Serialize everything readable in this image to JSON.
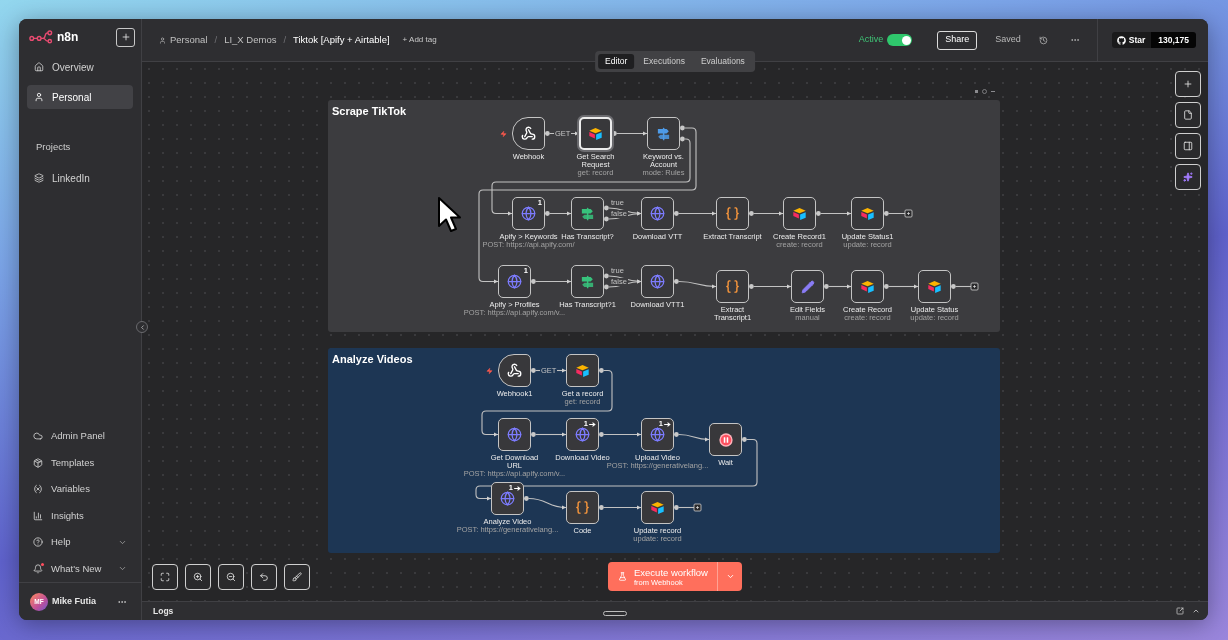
{
  "sidebar": {
    "logo": "n8n",
    "nav": [
      {
        "label": "Overview",
        "selected": false
      },
      {
        "label": "Personal",
        "selected": true
      }
    ],
    "projects_title": "Projects",
    "projects": [
      {
        "label": "LinkedIn",
        "selected": false
      }
    ],
    "bottom_nav": [
      {
        "label": "Admin Panel",
        "expandable": false,
        "notification": false
      },
      {
        "label": "Templates",
        "expandable": false,
        "notification": false
      },
      {
        "label": "Variables",
        "expandable": false,
        "notification": false
      },
      {
        "label": "Insights",
        "expandable": false,
        "notification": false
      },
      {
        "label": "Help",
        "expandable": true,
        "notification": false
      },
      {
        "label": "What's New",
        "expandable": true,
        "notification": true
      }
    ],
    "user": {
      "initials": "MF",
      "name": "Mike Futia"
    }
  },
  "header": {
    "breadcrumb": [
      {
        "label": "Personal",
        "separator": "/"
      },
      {
        "label": "LI_X Demos",
        "separator": "/"
      },
      {
        "label": "Tiktok [Apify + Airtable]"
      }
    ],
    "add_tag": "+ Add tag",
    "active": {
      "label": "Active",
      "on": true
    },
    "share": "Share",
    "saved": "Saved",
    "github": {
      "label": "Star",
      "count": "130,175"
    }
  },
  "view_tabs": [
    {
      "label": "Editor",
      "selected": true
    },
    {
      "label": "Executions",
      "selected": false
    },
    {
      "label": "Evaluations",
      "selected": false
    }
  ],
  "canvas": {
    "notes": [
      {
        "title": "Scrape TikTok",
        "color": "#3c3c3f",
        "nodes": [
          {
            "kind": "webhook",
            "label": "Webhook",
            "output_labels": [
              "GET"
            ],
            "selected": false
          },
          {
            "kind": "airtable",
            "label": "Get Search Request",
            "subtitle": "get: record",
            "selected": true
          },
          {
            "kind": "switch",
            "label": "Keyword vs. Account",
            "subtitle": "mode: Rules",
            "selected": false
          },
          {
            "kind": "http",
            "label": "Apify > Keywords",
            "subtitle": "POST: https://api.apify.com/",
            "run_count": "1",
            "run_arrow": false,
            "selected": false
          },
          {
            "kind": "if",
            "label": "Has Transcript?",
            "output_labels": [
              "true",
              "false"
            ],
            "selected": false
          },
          {
            "kind": "http",
            "label": "Download VTT",
            "selected": false
          },
          {
            "kind": "code",
            "label": "Extract Transcript",
            "selected": false
          },
          {
            "kind": "airtable",
            "label": "Create Record1",
            "subtitle": "create: record",
            "selected": false
          },
          {
            "kind": "airtable",
            "label": "Update Status1",
            "subtitle": "update: record",
            "selected": false
          },
          {
            "kind": "http",
            "label": "Apify > Profiles",
            "subtitle": "POST: https://api.apify.com/v...",
            "run_count": "1",
            "run_arrow": false,
            "selected": false
          },
          {
            "kind": "if",
            "label": "Has Transcript?1",
            "output_labels": [
              "true",
              "false"
            ],
            "selected": false
          },
          {
            "kind": "http",
            "label": "Download VTT1",
            "selected": false
          },
          {
            "kind": "code",
            "label": "Extract Transcript1",
            "selected": false
          },
          {
            "kind": "set",
            "label": "Edit Fields",
            "subtitle": "manual",
            "selected": false
          },
          {
            "kind": "airtable",
            "label": "Create Record",
            "subtitle": "create: record",
            "selected": false
          },
          {
            "kind": "airtable",
            "label": "Update Status",
            "subtitle": "update: record",
            "selected": false
          }
        ]
      },
      {
        "title": "Analyze Videos",
        "color": "#1d3654",
        "nodes": [
          {
            "kind": "webhook",
            "label": "Webhook1",
            "output_labels": [
              "GET"
            ],
            "selected": false
          },
          {
            "kind": "airtable",
            "label": "Get a record",
            "subtitle": "get: record",
            "selected": false
          },
          {
            "kind": "http",
            "label": "Get Download URL",
            "subtitle": "POST: https://api.apify.com/v...",
            "selected": false
          },
          {
            "kind": "http",
            "label": "Download Video",
            "run_count": "1",
            "run_arrow": true,
            "selected": false
          },
          {
            "kind": "http",
            "label": "Upload Video",
            "subtitle": "POST: https://generativelang...",
            "run_count": "1",
            "run_arrow": true,
            "selected": false
          },
          {
            "kind": "wait",
            "label": "Wait",
            "selected": false
          },
          {
            "kind": "http",
            "label": "Analyze Video",
            "subtitle": "POST: https://generativelang...",
            "run_count": "1",
            "run_arrow": true,
            "selected": false
          },
          {
            "kind": "code",
            "label": "Code",
            "selected": false
          },
          {
            "kind": "airtable",
            "label": "Update record",
            "subtitle": "update: record",
            "selected": false
          }
        ]
      }
    ]
  },
  "execute": {
    "label": "Execute workflow",
    "sublabel": "from Webhook"
  },
  "logs": {
    "title": "Logs"
  }
}
